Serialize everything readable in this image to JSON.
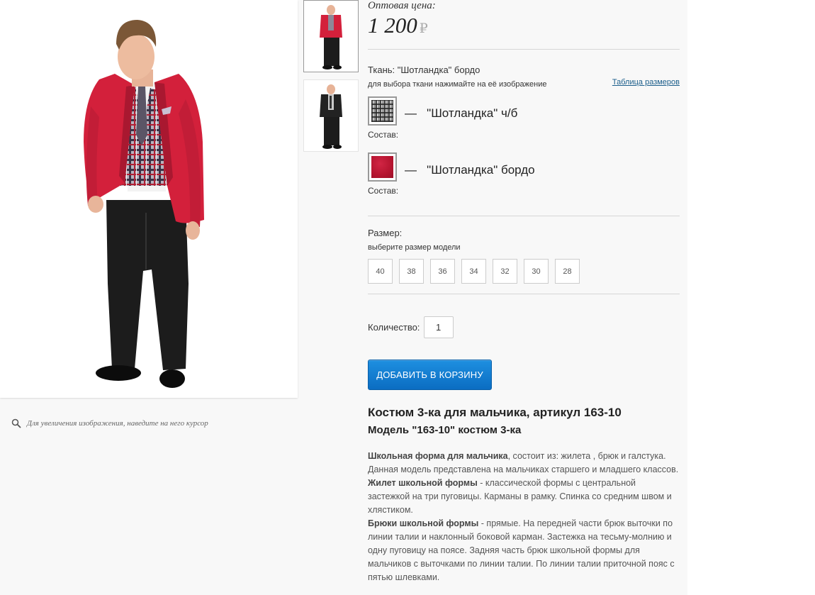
{
  "price": {
    "label": "Оптовая цена:",
    "value": "1 200",
    "currency": "₽"
  },
  "fabric": {
    "label": "Ткань: \"Шотландка\" бордо",
    "hint": "для выбора ткани нажимайте на её изображение",
    "size_table_link": "Таблица размеров",
    "options": [
      {
        "dash": "—",
        "name": "\"Шотландка\" ч/б",
        "composition": "Состав:",
        "swatch": "plaid"
      },
      {
        "dash": "—",
        "name": "\"Шотландка\" бордо",
        "composition": "Состав:",
        "swatch": "burgundy"
      }
    ]
  },
  "size": {
    "label": "Размер:",
    "hint": "выберите размер модели",
    "options": [
      "40",
      "38",
      "36",
      "34",
      "32",
      "30",
      "28"
    ]
  },
  "quantity": {
    "label": "Количество:",
    "value": "1"
  },
  "cart_button": "ДОБАВИТЬ В КОРЗИНУ",
  "gallery": {
    "zoom_hint": "Для увеличения изображения, наведите на него курсор"
  },
  "product": {
    "title": "Костюм 3-ка для мальчика, артикул 163-10",
    "subtitle": "Модель \"163-10\" костюм 3-ка"
  },
  "description": {
    "p1_bold": "Школьная форма для мальчика",
    "p1_text": ", состоит из:  жилета , брюк и галстука. Данная модель представлена на мальчиках старшего и младшего классов.",
    "p2_bold": "Жилет школьной формы",
    "p2_text": " - классической формы с центральной застежкой на три пуговицы. Карманы в рамку. Спинка со средним швом и хлястиком.",
    "p3_bold": "Брюки школьной формы",
    "p3_text": " - прямые. На передней части брюк выточки по линии талии и наклонный боковой карман. Застежка на тесьму-молнию и одну пуговицу на поясе. Задняя часть брюк школьной формы для мальчиков с выточками по линии талии. По линии талии приточной пояс с пятью шлевками."
  },
  "colors": {
    "accent_button": "#0b6dc2",
    "link": "#1a5d8a",
    "jacket_red": "#d3203b",
    "pants": "#1c1c1c"
  }
}
